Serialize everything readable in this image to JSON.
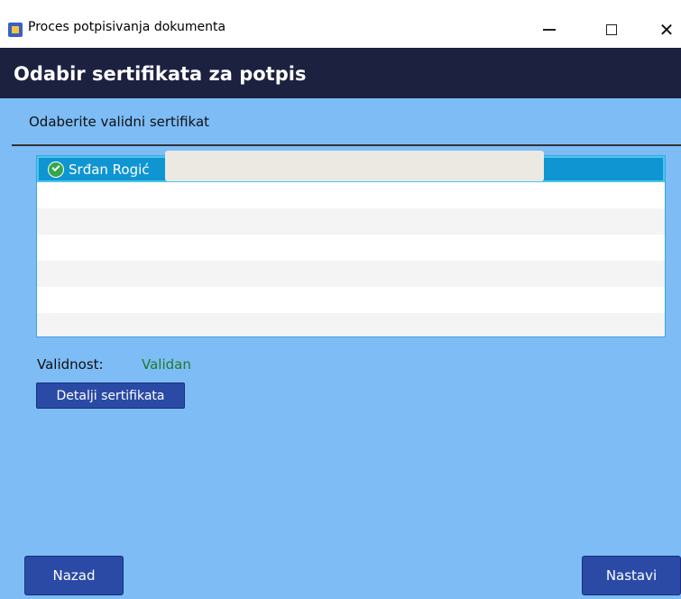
{
  "window": {
    "title": "Proces potpisivanja dokumenta"
  },
  "header": {
    "title": "Odabir sertifikata za potpis"
  },
  "content": {
    "instruction": "Odaberite validni sertifikat",
    "certificates": [
      {
        "name": "Srđan Rogić",
        "icon": "check-circle-icon",
        "selected": true
      }
    ],
    "validity_label": "Validnost:",
    "validity_value": "Validan",
    "details_button": "Detalji sertifikata"
  },
  "footer": {
    "back_label": "Nazad",
    "next_label": "Nastavi"
  },
  "colors": {
    "header_bg": "#1c2140",
    "body_bg": "#7ebcf6",
    "button_bg": "#2a4aa6",
    "selected_row": "#0f95d2",
    "valid_text": "#1f7a2e"
  }
}
